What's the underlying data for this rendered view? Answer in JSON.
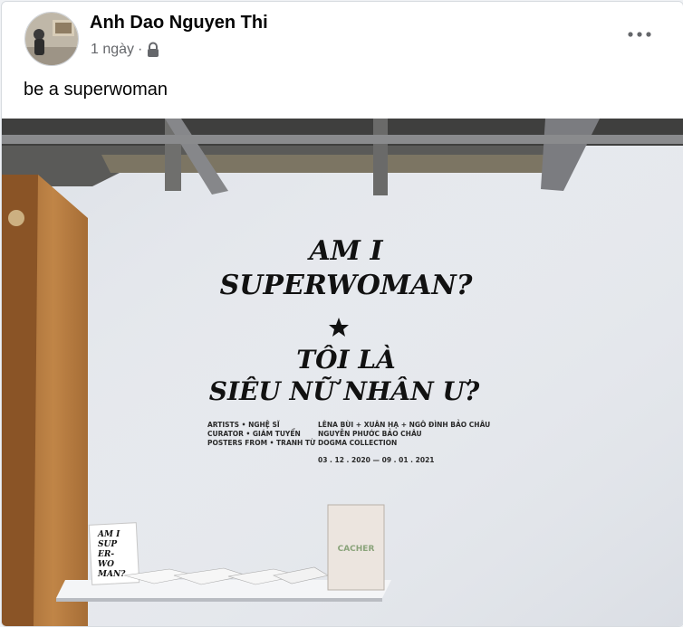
{
  "post": {
    "author": "Anh Dao Nguyen Thi",
    "time": "1 ngày",
    "separator": "·",
    "privacy_icon": "lock-icon",
    "menu_icon": "more-horizontal-icon",
    "caption": "be a superwoman"
  },
  "photo": {
    "wall_title_line1": "AM I",
    "wall_title_line2": "SUPERWOMAN?",
    "wall_title_vi_line1": "TÔI LÀ",
    "wall_title_vi_line2": "SIÊU NỮ NHÂN Ư?",
    "credits_left": [
      "ARTISTS • NGHỆ SĨ",
      "CURATOR • GIÁM TUYỂN",
      "POSTERS FROM • TRANH TỪ"
    ],
    "credits_right": [
      "LÊNA BÙI + XUÂN HẠ + NGÔ ĐÌNH BẢO CHÂU",
      "NGUYỄN PHƯỚC BẢO CHÂU",
      "DOGMA COLLECTION"
    ],
    "dates": "03 . 12 . 2020 — 09 . 01 . 2021",
    "book_title": "CACHER",
    "booklet_text": [
      "AM I",
      "SUP",
      "ER-",
      "WO",
      "MAN?"
    ]
  },
  "colors": {
    "text_primary": "#050505",
    "text_secondary": "#65676b",
    "wall": "#e6e9ee",
    "wood": "#b87a3e"
  }
}
